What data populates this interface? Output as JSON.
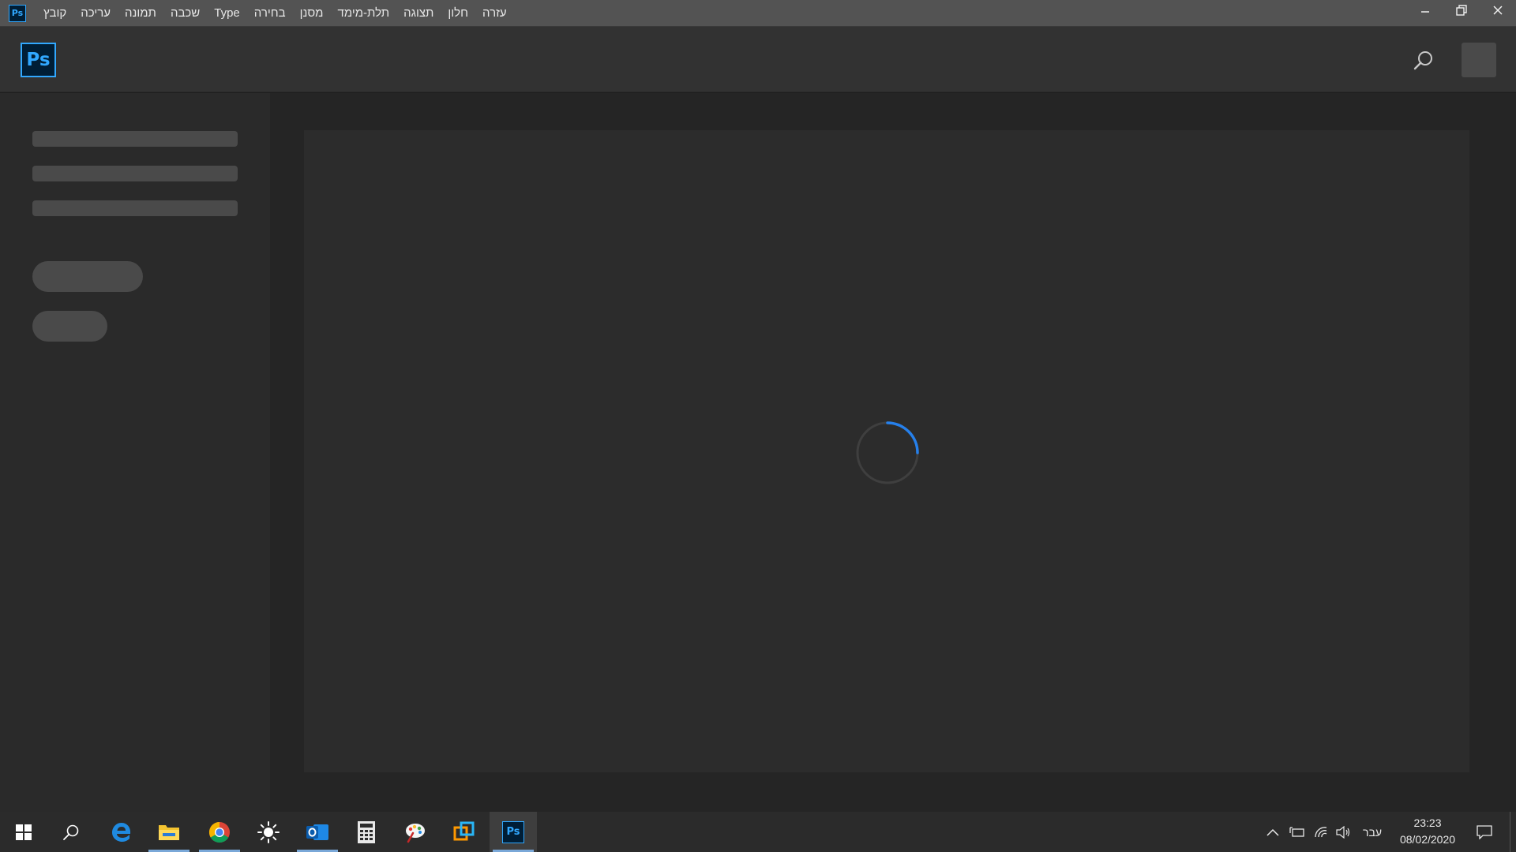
{
  "titlebar": {
    "app_icon_label": "Ps",
    "menu": [
      {
        "label": "קובץ",
        "name": "menu-file"
      },
      {
        "label": "עריכה",
        "name": "menu-edit"
      },
      {
        "label": "תמונה",
        "name": "menu-image"
      },
      {
        "label": "שכבה",
        "name": "menu-layer"
      },
      {
        "label": "Type",
        "name": "menu-type"
      },
      {
        "label": "בחירה",
        "name": "menu-select"
      },
      {
        "label": "מסנן",
        "name": "menu-filter"
      },
      {
        "label": "תלת-מימד",
        "name": "menu-3d"
      },
      {
        "label": "תצוגה",
        "name": "menu-view"
      },
      {
        "label": "חלון",
        "name": "menu-window"
      },
      {
        "label": "עזרה",
        "name": "menu-help"
      }
    ],
    "window_controls": [
      "minimize-icon",
      "restore-icon",
      "close-icon"
    ]
  },
  "header": {
    "logo_label": "Ps",
    "search_icon": "search-icon",
    "avatar": "avatar-placeholder"
  },
  "workspace": {
    "loading": true,
    "spinner_color": "#2680eb"
  },
  "colors": {
    "ps_blue": "#31a8ff",
    "ps_dark": "#001e36",
    "menubar": "#535353",
    "header": "#323232",
    "workspace": "#252525"
  },
  "taskbar": {
    "apps": [
      {
        "name": "start-button",
        "icon": "windows-icon"
      },
      {
        "name": "taskbar-search",
        "icon": "search-icon"
      },
      {
        "name": "taskbar-edge",
        "icon": "edge-icon"
      },
      {
        "name": "taskbar-file-explorer",
        "icon": "folder-icon"
      },
      {
        "name": "taskbar-chrome",
        "icon": "chrome-icon"
      },
      {
        "name": "taskbar-brightness",
        "icon": "sun-icon"
      },
      {
        "name": "taskbar-outlook",
        "icon": "outlook-icon"
      },
      {
        "name": "taskbar-calculator",
        "icon": "calculator-icon"
      },
      {
        "name": "taskbar-paint",
        "icon": "paint-icon"
      },
      {
        "name": "taskbar-remote",
        "icon": "windows-orange-icon"
      },
      {
        "name": "taskbar-photoshop",
        "icon": "photoshop-icon",
        "label": "Ps"
      }
    ],
    "tray": {
      "language": "עבר",
      "time": "23:23",
      "date": "08/02/2020"
    }
  }
}
